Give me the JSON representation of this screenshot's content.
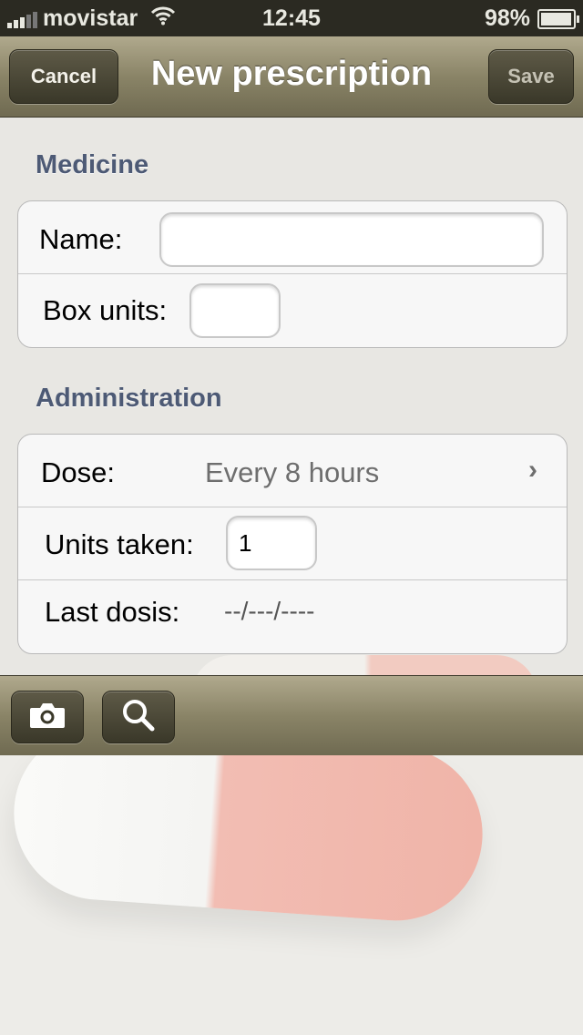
{
  "status_bar": {
    "carrier": "movistar",
    "time": "12:45",
    "battery": "98%",
    "battery_level": 0.98
  },
  "nav": {
    "title": "New prescription",
    "cancel_label": "Cancel",
    "save_label": "Save"
  },
  "medicine": {
    "section_title": "Medicine",
    "name_label": "Name:",
    "name_value": "",
    "box_units_label": "Box units:",
    "box_units_value": ""
  },
  "administration": {
    "section_title": "Administration",
    "dose_label": "Dose:",
    "dose_value": "Every 8 hours",
    "units_taken_label": "Units taken:",
    "units_taken_value": "1",
    "last_dosis_label": "Last dosis:",
    "last_dosis_value": "--/---/----"
  },
  "toolbar": {
    "camera_icon": "camera-icon",
    "search_icon": "search-icon"
  },
  "colors": {
    "section_title": "#4d5a75",
    "bar": "#8a8467",
    "button": "#3a3829"
  }
}
